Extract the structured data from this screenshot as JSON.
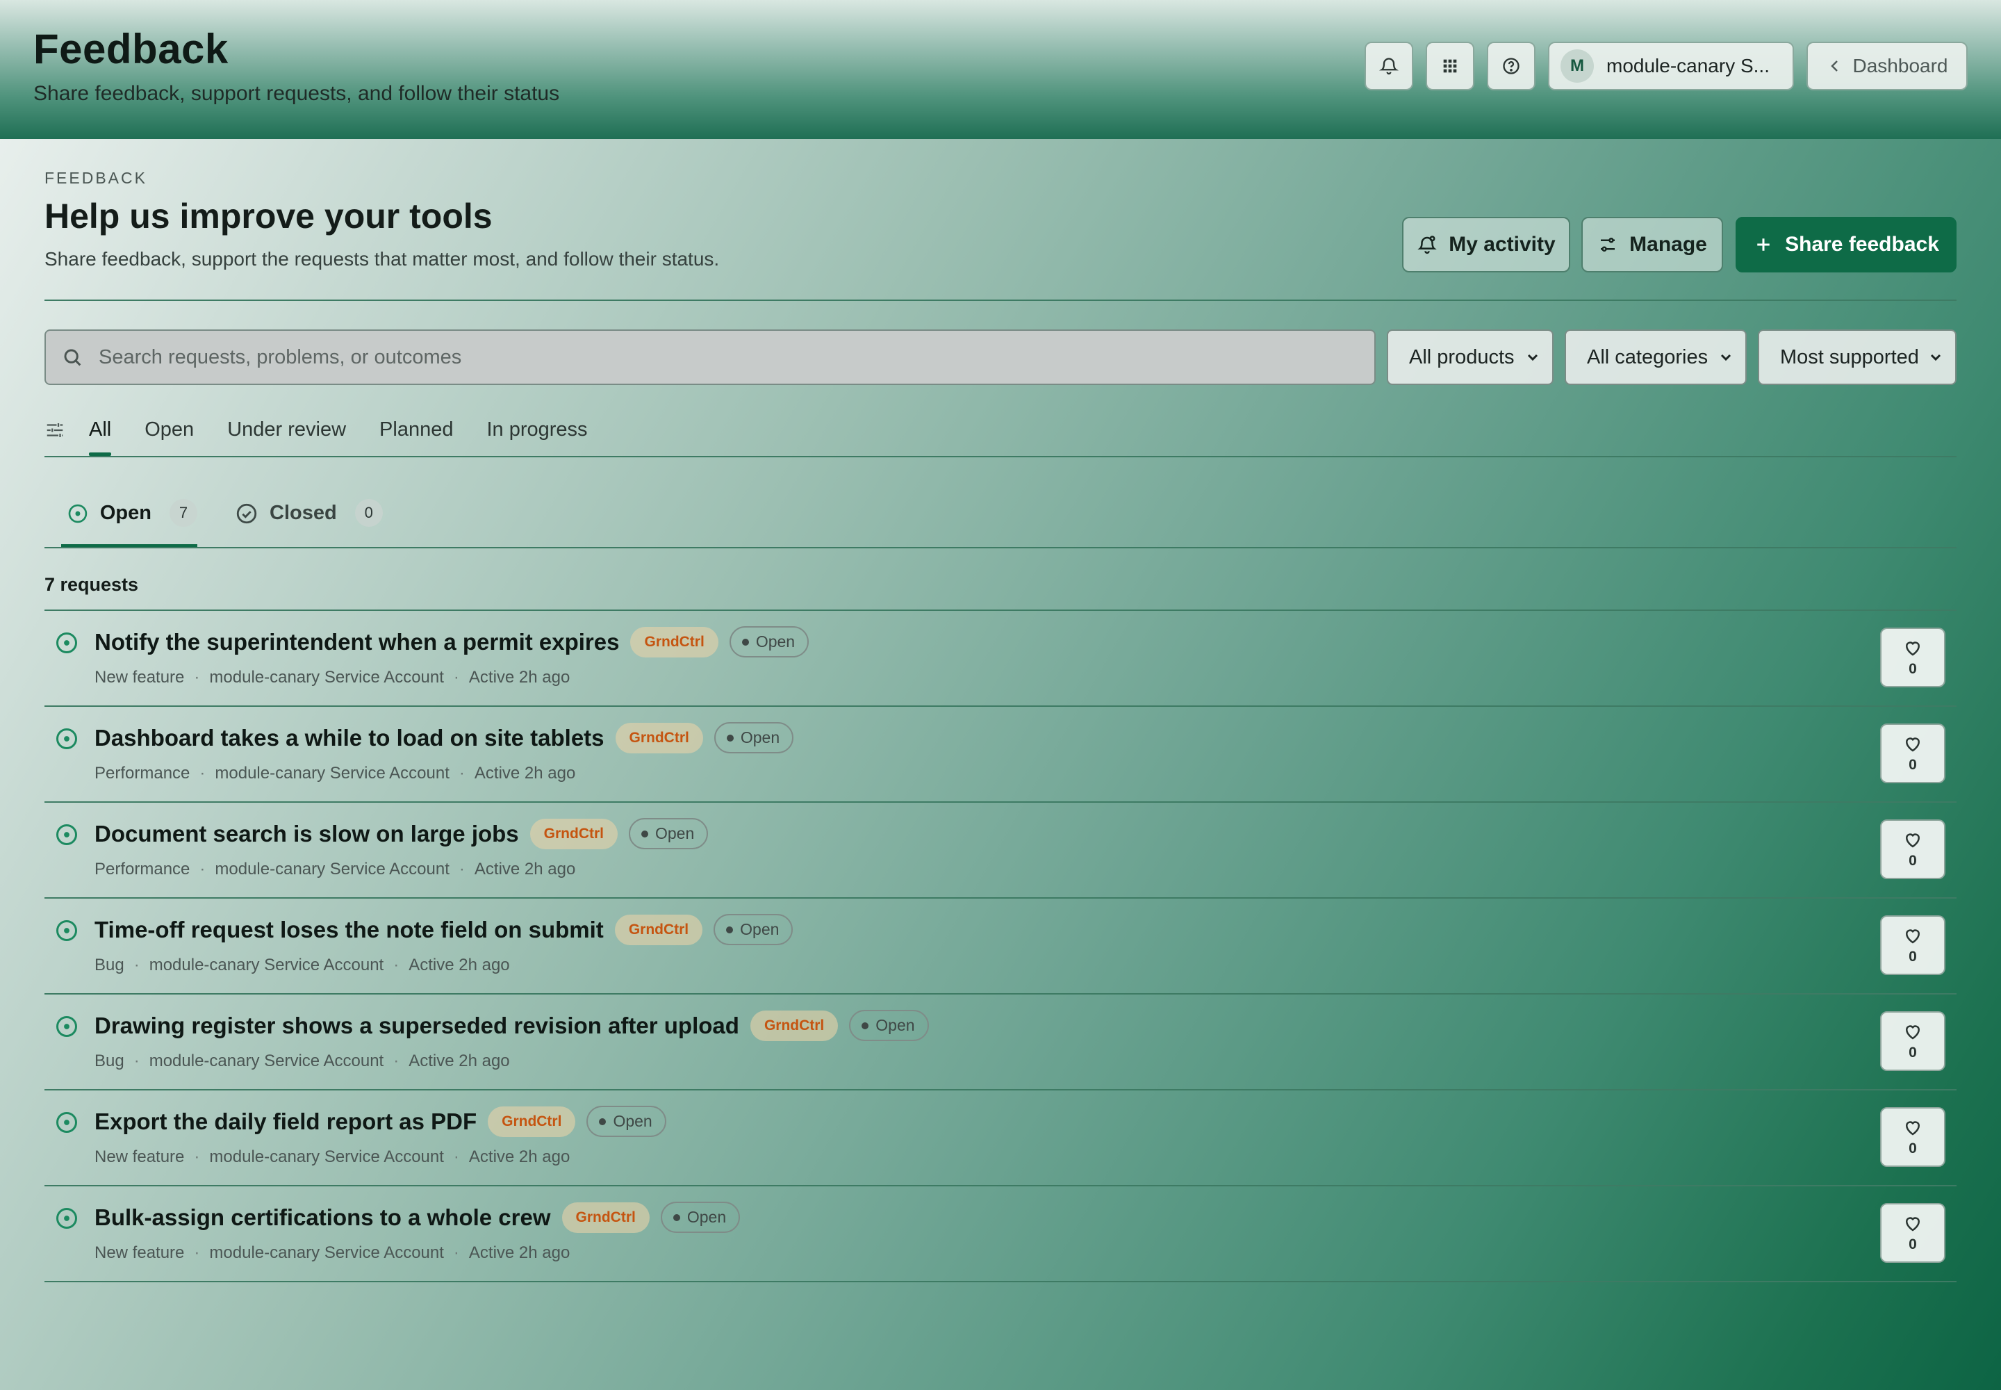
{
  "header": {
    "title": "Feedback",
    "subtitle": "Share feedback, support requests, and follow their status",
    "user_initial": "M",
    "user_name": "module-canary S...",
    "dashboard_label": "Dashboard",
    "icons": [
      "bell-icon",
      "apps-grid-icon",
      "help-icon"
    ]
  },
  "page": {
    "eyebrow": "FEEDBACK",
    "heading": "Help us improve your tools",
    "lede": "Share feedback, support the requests that matter most, and follow their status.",
    "my_activity_label": "My activity",
    "manage_label": "Manage",
    "share_label": "Share feedback"
  },
  "search": {
    "placeholder": "Search requests, problems, or outcomes",
    "value": ""
  },
  "selects": {
    "products": "All products",
    "categories": "All categories",
    "sort": "Most supported"
  },
  "filters": [
    "All",
    "Open",
    "Under review",
    "Planned",
    "In progress"
  ],
  "active_filter": "All",
  "state_tabs": [
    {
      "label": "Open",
      "count": "7"
    },
    {
      "label": "Closed",
      "count": "0"
    }
  ],
  "request_count_label": "7 requests",
  "requests": [
    {
      "title": "Notify the superintendent when a permit expires",
      "product": "GrndCtrl",
      "status": "Open",
      "category": "New feature",
      "author": "module-canary Service Account",
      "activity": "Active 2h ago",
      "votes": "0"
    },
    {
      "title": "Dashboard takes a while to load on site tablets",
      "product": "GrndCtrl",
      "status": "Open",
      "category": "Performance",
      "author": "module-canary Service Account",
      "activity": "Active 2h ago",
      "votes": "0"
    },
    {
      "title": "Document search is slow on large jobs",
      "product": "GrndCtrl",
      "status": "Open",
      "category": "Performance",
      "author": "module-canary Service Account",
      "activity": "Active 2h ago",
      "votes": "0"
    },
    {
      "title": "Time-off request loses the note field on submit",
      "product": "GrndCtrl",
      "status": "Open",
      "category": "Bug",
      "author": "module-canary Service Account",
      "activity": "Active 2h ago",
      "votes": "0"
    },
    {
      "title": "Drawing register shows a superseded revision after upload",
      "product": "GrndCtrl",
      "status": "Open",
      "category": "Bug",
      "author": "module-canary Service Account",
      "activity": "Active 2h ago",
      "votes": "0"
    },
    {
      "title": "Export the daily field report as PDF",
      "product": "GrndCtrl",
      "status": "Open",
      "category": "New feature",
      "author": "module-canary Service Account",
      "activity": "Active 2h ago",
      "votes": "0"
    },
    {
      "title": "Bulk-assign certifications to a whole crew",
      "product": "GrndCtrl",
      "status": "Open",
      "category": "New feature",
      "author": "module-canary Service Account",
      "activity": "Active 2h ago",
      "votes": "0"
    }
  ],
  "colors": {
    "accent": "#0e6b47",
    "product_badge": "#c55410"
  }
}
